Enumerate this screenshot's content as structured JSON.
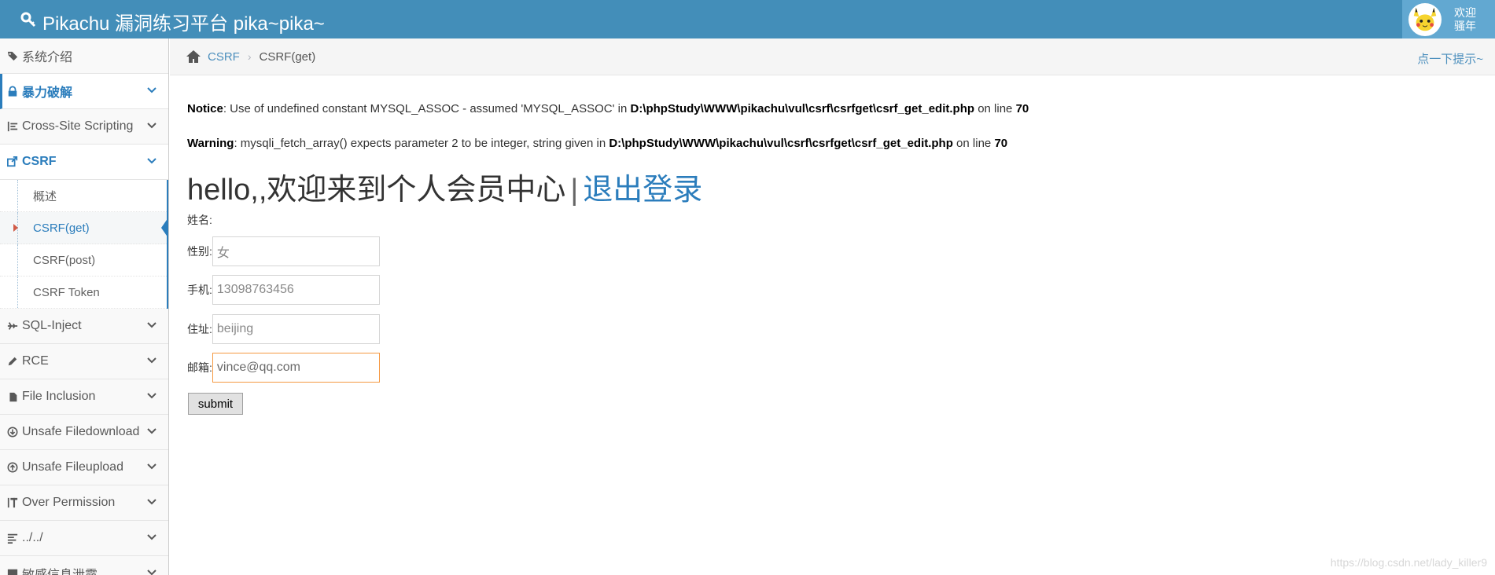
{
  "app": {
    "title": "Pikachu 漏洞练习平台 pika~pika~",
    "welcome_line1": "欢迎",
    "welcome_line2": "骚年"
  },
  "sidebar": {
    "items": [
      {
        "label": "系统介绍",
        "icon": "tags-icon"
      },
      {
        "label": "暴力破解",
        "icon": "lock-icon"
      },
      {
        "label": "Cross-Site Scripting",
        "icon": "indent-icon"
      },
      {
        "label": "CSRF",
        "icon": "share-icon"
      },
      {
        "label": "SQL-Inject",
        "icon": "plane-icon"
      },
      {
        "label": "RCE",
        "icon": "pencil-icon"
      },
      {
        "label": "File Inclusion",
        "icon": "file-icon"
      },
      {
        "label": "Unsafe Filedownload",
        "icon": "download-icon"
      },
      {
        "label": "Unsafe Fileupload",
        "icon": "upload-icon"
      },
      {
        "label": "Over Permission",
        "icon": "text-height-icon"
      },
      {
        "label": "../../",
        "icon": "align-left-icon"
      },
      {
        "label": "敏感信息泄露",
        "icon": "info-icon"
      }
    ],
    "csrf_sub": [
      {
        "label": "概述"
      },
      {
        "label": "CSRF(get)"
      },
      {
        "label": "CSRF(post)"
      },
      {
        "label": "CSRF Token"
      }
    ]
  },
  "breadcrumb": {
    "parent": "CSRF",
    "separator": "›",
    "current": "CSRF(get)",
    "hint": "点一下提示~"
  },
  "main": {
    "notice_label": "Notice",
    "notice_text": ": Use of undefined constant MYSQL_ASSOC - assumed 'MYSQL_ASSOC' in ",
    "notice_path": "D:\\phpStudy\\WWW\\pikachu\\vul\\csrf\\csrfget\\csrf_get_edit.php",
    "notice_online": " on line ",
    "notice_line": "70",
    "warning_label": "Warning",
    "warning_text": ": mysqli_fetch_array() expects parameter 2 to be integer, string given in ",
    "warning_path": "D:\\phpStudy\\WWW\\pikachu\\vul\\csrf\\csrfget\\csrf_get_edit.php",
    "warning_online": " on line ",
    "warning_line": "70",
    "heading": "hello,,欢迎来到个人会员中心",
    "heading_sep": "|",
    "logout": "退出登录",
    "name_label": "姓名:",
    "gender_label": "性别:",
    "gender_value": "女",
    "phone_label": "手机:",
    "phone_value": "13098763456",
    "address_label": "住址:",
    "address_value": "beijing",
    "email_label": "邮箱:",
    "email_value": "vince@qq.com",
    "submit_label": "submit"
  },
  "watermark": "https://blog.csdn.net/lady_killer9",
  "colors": {
    "navbar": "#438eb9",
    "accent": "#2b7dbc",
    "focus": "#f59942"
  }
}
